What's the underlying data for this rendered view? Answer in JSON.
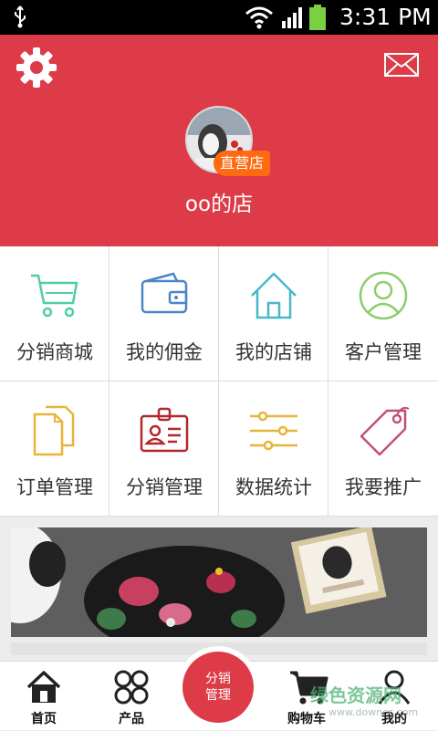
{
  "status": {
    "time": "3:31 PM"
  },
  "header": {
    "badge": "直营店",
    "shop_name": "oo的店",
    "color": "#dc3b47"
  },
  "grid": [
    {
      "label": "分销商城",
      "icon": "shopping-cart-icon",
      "color": "#4fcf9e"
    },
    {
      "label": "我的佣金",
      "icon": "wallet-icon",
      "color": "#4a86c8"
    },
    {
      "label": "我的店铺",
      "icon": "home-icon",
      "color": "#48b8c8"
    },
    {
      "label": "客户管理",
      "icon": "user-circle-icon",
      "color": "#8ccc6e"
    },
    {
      "label": "订单管理",
      "icon": "documents-icon",
      "color": "#e8b43a"
    },
    {
      "label": "分销管理",
      "icon": "id-card-icon",
      "color": "#b0282e"
    },
    {
      "label": "数据统计",
      "icon": "sliders-icon",
      "color": "#e8b43a"
    },
    {
      "label": "我要推广",
      "icon": "tag-icon",
      "color": "#c0507a"
    }
  ],
  "tabs": [
    {
      "label": "首页",
      "icon": "home-icon"
    },
    {
      "label": "产品",
      "icon": "grid-icon"
    },
    {
      "label": "分销\n管理",
      "icon": ""
    },
    {
      "label": "购物车",
      "icon": "cart-icon"
    },
    {
      "label": "我的",
      "icon": "user-icon"
    }
  ],
  "center_button": {
    "line1": "分销",
    "line2": "管理"
  },
  "watermark": {
    "text": "绿色资源网",
    "url": "www.downcc.com"
  }
}
